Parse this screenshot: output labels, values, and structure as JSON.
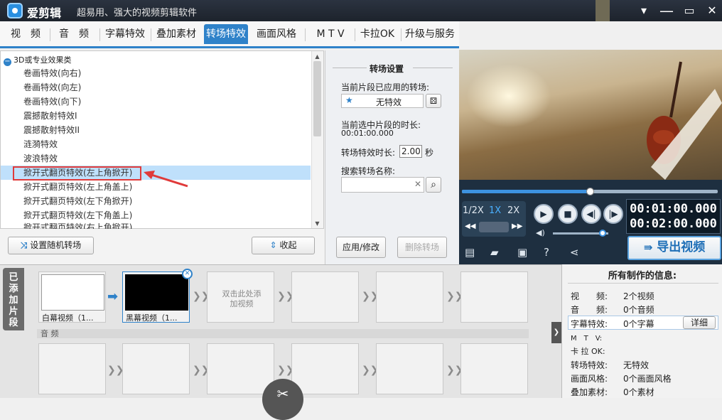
{
  "titlebar": {
    "app_name": "爱剪辑",
    "slogan": "超易用、强大的视频剪辑软件",
    "minimize": "▾",
    "maximize": "▭",
    "restore": "❐",
    "close": "✕"
  },
  "tabs": [
    "视　频",
    "音　频",
    "字幕特效",
    "叠加素材",
    "转场特效",
    "画面风格",
    "M T V",
    "卡拉OK",
    "升级与服务"
  ],
  "effects": {
    "category": "3D或专业效果类",
    "items": [
      "卷画特效(向右)",
      "卷画特效(向左)",
      "卷画特效(向下)",
      "震撼散射特效I",
      "震撼散射特效II",
      "涟漪特效",
      "波浪特效",
      "掀开式翻页特效(左上角掀开)",
      "掀开式翻页特效(左上角盖上)",
      "掀开式翻页特效(左下角掀开)",
      "掀开式翻页特效(左下角盖上)",
      "掀开式翻页特效(右上角掀开)"
    ],
    "selected_index": 7
  },
  "buttons": {
    "random": "设置随机转场",
    "collapse": "收起",
    "apply": "应用/修改",
    "delete": "删除转场"
  },
  "settings": {
    "title": "转场设置",
    "applied_label": "当前片段已应用的转场:",
    "applied_value": "无特效",
    "duration_label": "当前选中片段的时长:",
    "duration_value": "00:01:00.000",
    "effect_dur_label": "转场特效时长:",
    "effect_dur_value": "2.00",
    "effect_dur_unit": "秒",
    "search_label": "搜索转场名称:",
    "search_value": ""
  },
  "player": {
    "speeds": [
      "1/2X",
      "1X",
      "2X"
    ],
    "time_current": "00:01:00.000",
    "time_total": "00:02:00.000",
    "export": "导出视频",
    "progress": 0.5,
    "volume": 0.9
  },
  "timeline": {
    "tab": "已添加片段",
    "clips": [
      {
        "name": "白幕视频（1..."
      },
      {
        "name": "黑幕视频（1..."
      }
    ],
    "add_hint": "双击此处添加视频",
    "audio_label": "音 频"
  },
  "info": {
    "title": "所有制作的信息:",
    "detail_button": "详细",
    "rows": [
      {
        "k": "视　　频:",
        "v": "2个视频"
      },
      {
        "k": "音　　频:",
        "v": "0个音频"
      },
      {
        "k": "字幕特效:",
        "v": "0个字幕"
      },
      {
        "k": "M　T　V:",
        "v": ""
      },
      {
        "k": "卡 拉 OK:",
        "v": ""
      },
      {
        "k": "转场特效:",
        "v": "无特效"
      },
      {
        "k": "画面风格:",
        "v": "0个画面风格"
      },
      {
        "k": "叠加素材:",
        "v": "0个素材"
      }
    ]
  }
}
